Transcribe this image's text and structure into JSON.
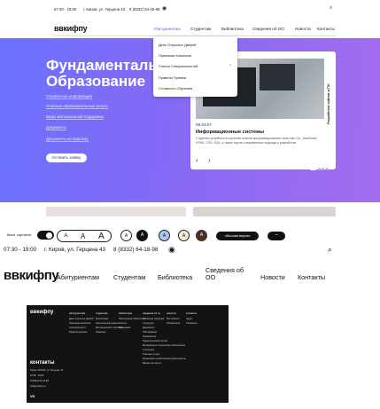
{
  "topbar": {
    "hours": "07:30 - 19:00",
    "address": "г. Киров, ул. Герцена 43",
    "phone": "8 (8332) 64-18-98"
  },
  "header": {
    "logo": "ввкифпу",
    "nav": [
      "Абитуриентам",
      "Студентам",
      "Библиотека",
      "Сведения об ОО",
      "Новости",
      "Контакты"
    ]
  },
  "dropdown": [
    "День Открытых Дверей",
    "Приемная Комиссия",
    "Список Специальностей",
    "Правила Приема",
    "Стоимость Обучения"
  ],
  "hero": {
    "title1": "Фундаментально",
    "title2": "Образование",
    "links": [
      "Справочная информация",
      "Платные образовательные услуги",
      "Виды материальной поддержки",
      "Документы",
      "Документы на практику"
    ],
    "button": "Оставить заявку"
  },
  "card": {
    "side": "Разработка сайтов и ПО",
    "date": "09.03.07",
    "title": "Информационные системы",
    "desc": "Студенты углубятся в изучение языков программирования таких как, C#, JavaScript, HTML, CSS, SQL, а также изучат современные подходы к разработке",
    "prev": "‹",
    "next": "›"
  },
  "access": {
    "images_label": "Выкл. картинки",
    "font_sizes": [
      "A",
      "A",
      "A"
    ],
    "color_modes": [
      "A",
      "A",
      "A",
      "A",
      "A"
    ],
    "normal_button": "обычная версия",
    "colors": {
      "blue": "#a8c8f0",
      "beige": "#f3ecd6",
      "brown": "#4a3324"
    }
  },
  "header2": {
    "hours": "07:30 - 19:00",
    "address": "г. Киров, ул. Герцена 43",
    "phone": "8 (8332) 64-18-98",
    "logo": "ввкифпу",
    "nav": [
      "Абитуриентам",
      "Студентам",
      "Библиотека",
      "Сведения об ОО",
      "Новости",
      "Контакты"
    ]
  },
  "footer": {
    "logo": "ввкифпу",
    "cols": [
      {
        "head": "абитуриентам",
        "items": [
          "День открытых дверей",
          "Приемная комиссия",
          "Специальности",
          "Правила приема"
        ]
      },
      {
        "head": "студентам",
        "items": [
          "Расписание",
          "Электронный журнал",
          "Дистанционное обучение",
          "Практика"
        ]
      },
      {
        "head": "библиотека",
        "items": [
          "Электронная библиотека",
          "Каталог",
          "Периодика"
        ]
      },
      {
        "head": "сведения об оо",
        "items": [
          "Основные сведения",
          "Структура",
          "Документы",
          "Образование",
          "Руководство",
          "Педагогический состав",
          "Материально-техническое обеспечение",
          "Стипендии",
          "Платные услуги",
          "Финансово-хозяйственная деятельность",
          "Вакантные места"
        ]
      },
      {
        "head": "новости",
        "items": [
          "Все новости",
          "Объявления"
        ]
      },
      {
        "head": "контакты",
        "items": [
          "Адрес",
          "Телефоны"
        ]
      }
    ],
    "contacts_head": "контакты",
    "contacts": [
      "Киров, 610014, ул. Герцена, 43",
      "07:30 - 19:00",
      "8 (8332) 64-18-98",
      "info@vvkifpu.ru"
    ],
    "social": "VK"
  }
}
